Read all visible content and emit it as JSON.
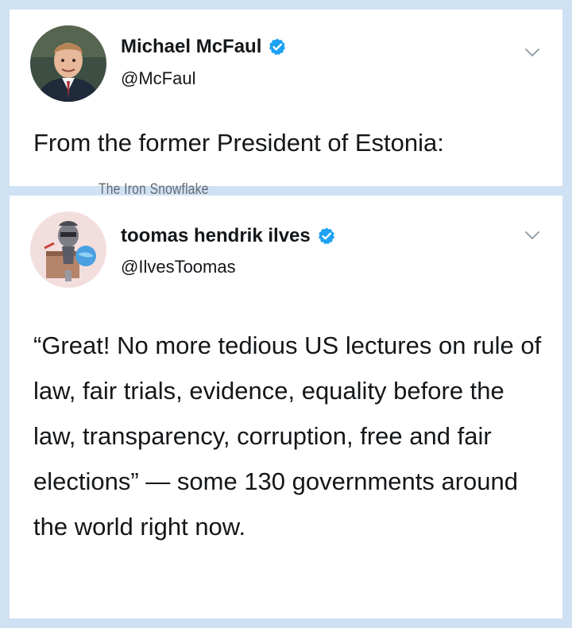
{
  "tweet_1": {
    "display_name": "Michael McFaul",
    "handle": "@McFaul",
    "text": "From the former President of Estonia:",
    "avatar_icon": "portrait-avatar",
    "verified_icon": "verified-badge-icon",
    "menu_icon": "chevron-down-icon"
  },
  "watermark": {
    "text": "The Iron Snowflake"
  },
  "tweet_2": {
    "display_name": "toomas hendrik ilves",
    "handle": "@IlvesToomas",
    "text": "“Great! No more tedious US lectures on rule of law, fair trials, evidence, equality before the law, transparency, corruption, free and fair elections” — some 130 governments around the world right now.",
    "avatar_icon": "illustrated-portrait-avatar",
    "verified_icon": "verified-badge-icon",
    "menu_icon": "chevron-down-icon"
  },
  "colors": {
    "background": "#cfe2f4",
    "card": "#ffffff",
    "text": "#14171a",
    "verified": "#1da1f2",
    "chevron": "#8899a6"
  }
}
